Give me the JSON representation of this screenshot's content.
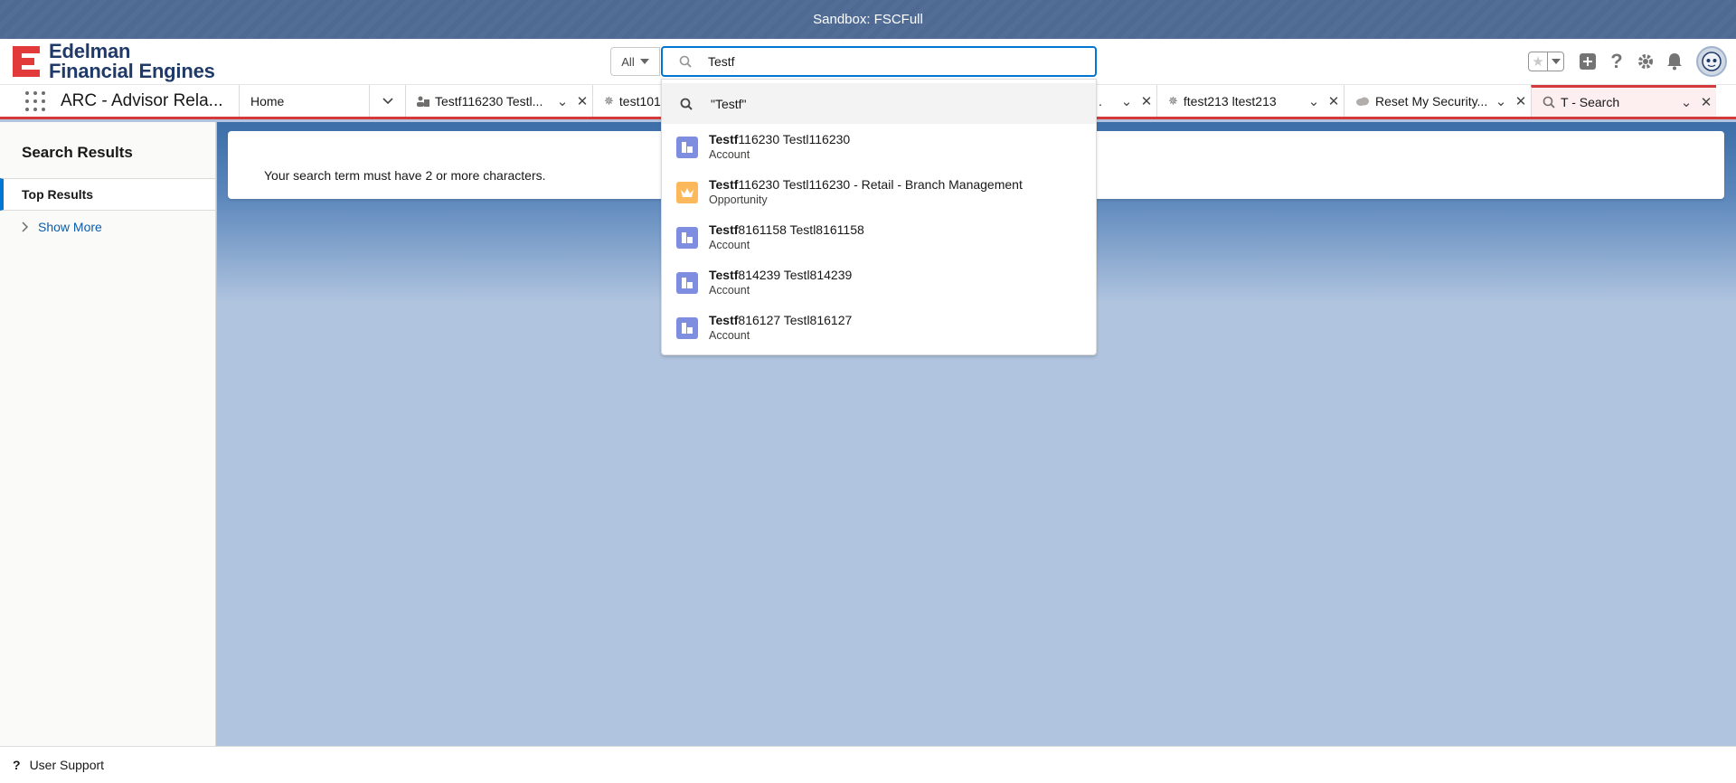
{
  "sandbox_banner": "Sandbox: FSCFull",
  "logo": {
    "line1": "Edelman",
    "line2": "Financial Engines"
  },
  "search": {
    "scope": "All",
    "query": "Testf",
    "suggestion_query": "\"Testf\"",
    "results": [
      {
        "match": "Testf",
        "rest": "116230 Testl116230",
        "type": "Account",
        "icon": "account-icon"
      },
      {
        "match": "Testf",
        "rest": "116230 Testl116230 - Retail - Branch Management",
        "type": "Opportunity",
        "icon": "opportunity-icon"
      },
      {
        "match": "Testf",
        "rest": "8161158 Testl8161158",
        "type": "Account",
        "icon": "account-icon"
      },
      {
        "match": "Testf",
        "rest": "814239 Testl814239",
        "type": "Account",
        "icon": "account-icon"
      },
      {
        "match": "Testf",
        "rest": "816127 Testl816127",
        "type": "Account",
        "icon": "account-icon"
      }
    ]
  },
  "nav": {
    "app_name": "ARC - Advisor Rela...",
    "tabs": [
      {
        "label": "Home",
        "icon": ""
      },
      {
        "label": "Testf116230 Testl...",
        "icon": "person-account-icon"
      },
      {
        "label": "test101",
        "icon": "star-icon"
      },
      {
        "label": ".",
        "icon": ""
      },
      {
        "label": "ftest213 ltest213",
        "icon": "star-icon"
      },
      {
        "label": "Reset My Security...",
        "icon": "cloud-icon"
      },
      {
        "label": "T - Search",
        "icon": "search-icon"
      }
    ]
  },
  "left_panel": {
    "title": "Search Results",
    "top_results": "Top Results",
    "show_more": "Show More"
  },
  "main": {
    "message": "Your search term must have 2 or more characters."
  },
  "footer": {
    "user_support": "User Support"
  },
  "colors": {
    "brand_blue": "#0176d3",
    "accent_red": "#d43a3a",
    "account_icon": "#7f8de1",
    "opportunity_icon": "#fcb95b"
  }
}
